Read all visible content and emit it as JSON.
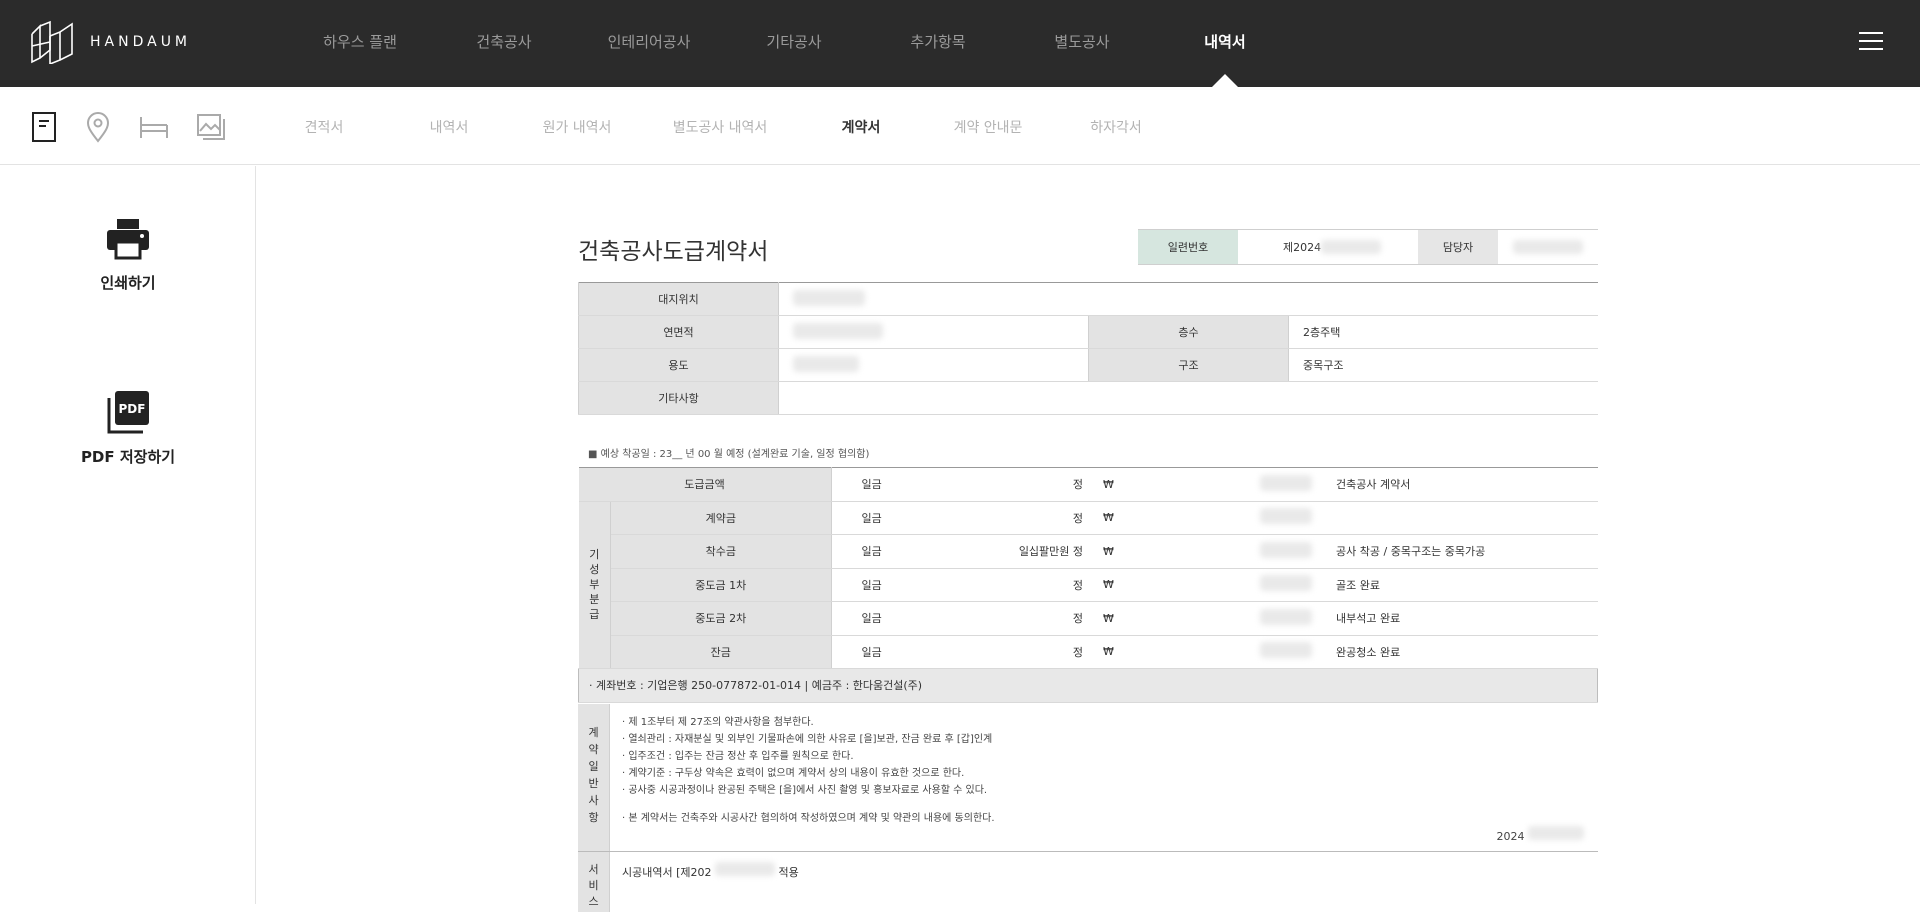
{
  "brand": {
    "name": "HANDAUM"
  },
  "main_nav": {
    "items": [
      {
        "label": "하우스 플랜"
      },
      {
        "label": "건축공사"
      },
      {
        "label": "인테리어공사"
      },
      {
        "label": "기타공사"
      },
      {
        "label": "추가항목"
      },
      {
        "label": "별도공사"
      },
      {
        "label": "내역서",
        "active": true
      }
    ]
  },
  "sub_nav": {
    "icons": [
      "document-icon",
      "location-pin-icon",
      "bed-icon",
      "image-icon"
    ],
    "items": [
      {
        "label": "견적서"
      },
      {
        "label": "내역서"
      },
      {
        "label": "원가 내역서"
      },
      {
        "label": "별도공사 내역서"
      },
      {
        "label": "계약서",
        "active": true
      },
      {
        "label": "계약 안내문"
      },
      {
        "label": "하자각서"
      }
    ]
  },
  "side": {
    "print_label": "인쇄하기",
    "pdf_label": "PDF 저장하기",
    "pdf_icon_text": "PDF"
  },
  "doc": {
    "title": "건축공사도급계약서",
    "serial_label": "일련번호",
    "serial_value": "제2024",
    "manager_label": "담당자",
    "info": {
      "site_label": "대지위치",
      "area_label": "연면적",
      "floors_label": "층수",
      "floors_value": "2층주택",
      "use_label": "용도",
      "structure_label": "구조",
      "structure_value": "중목구조",
      "etc_label": "기타사항"
    },
    "start_note": "■ 예상 착공일 : 23__ 년 00 월 예정 (설계완료 기술, 일정 협의함)",
    "payments": {
      "vertical_label": [
        "기",
        "성",
        "부",
        "분",
        "급"
      ],
      "won_prefix": "일금",
      "jeong": "정",
      "won_sign": "₩",
      "rows": [
        {
          "label": "도급금액",
          "jeong": "정",
          "note": "건축공사 계약서"
        },
        {
          "label": "계약금",
          "jeong": "정",
          "note": ""
        },
        {
          "label": "착수금",
          "jeong": "일십팔만원 정",
          "note": "공사 착공 / 중목구조는 중목가공"
        },
        {
          "label": "중도금 1차",
          "jeong": "정",
          "note": "골조 완료"
        },
        {
          "label": "중도금 2차",
          "jeong": "정",
          "note": "내부석고 완료"
        },
        {
          "label": "잔금",
          "jeong": "정",
          "note": "완공청소 완료"
        }
      ],
      "account": "· 계좌번호 : 기업은행 250-077872-01-014 | 예금주 : 한다움건설(주)"
    },
    "terms": {
      "vertical_label": [
        "계",
        "약",
        "일",
        "반",
        "사",
        "항"
      ],
      "lines": [
        "· 제 1조부터 제 27조의 약관사항을 첨부한다.",
        "· 열쇠관리 : 자재분실 및 외부인 기물파손에 의한 사유로 [을]보관, 잔금 완료 후 [갑]인계",
        "· 입주조건 : 입주는 잔금 정산 후 입주를 원칙으로 한다.",
        "· 계약기준 : 구두상 약속은 효력이 없으며 계약서 상의 내용이 유효한 것으로 한다.",
        "· 공사중 시공과정이나 완공된 주택은 [을]에서 사진 촬영 및 홍보자료로 사용할 수 있다.",
        "· 본 계약서는 건축주와 시공사간 협의하여 작성하였으며 계약 및 약관의 내용에 동의한다."
      ],
      "date_prefix": "2024"
    },
    "service": {
      "vertical_label": [
        "서",
        "비",
        "스"
      ],
      "text_prefix": "시공내역서 [제202",
      "text_suffix": "적용"
    }
  }
}
